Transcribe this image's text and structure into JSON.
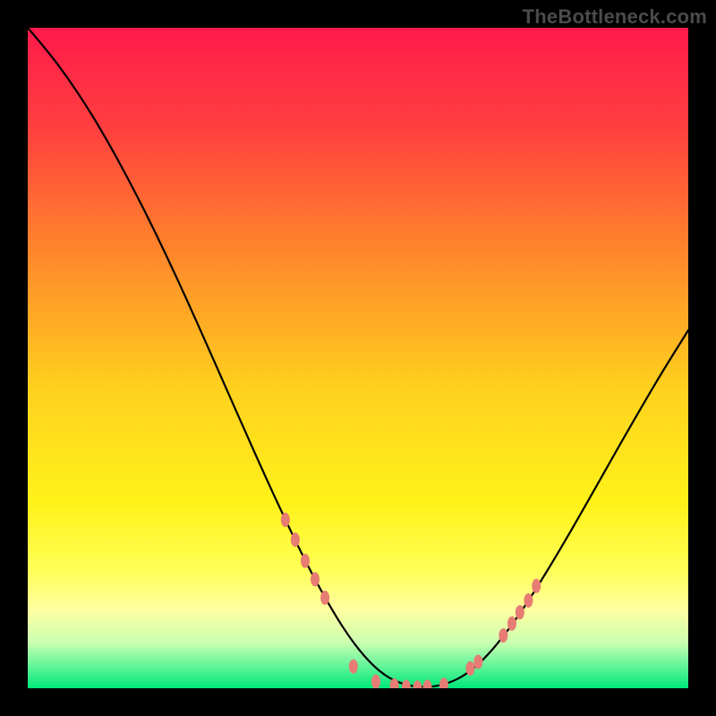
{
  "attribution": "TheBottleneck.com",
  "chart_data": {
    "type": "line",
    "title": "",
    "xlabel": "",
    "ylabel": "",
    "xlim": [
      0,
      100
    ],
    "ylim": [
      0,
      100
    ],
    "grid": false,
    "legend": false,
    "background_gradient": {
      "stops": [
        {
          "offset": 0.0,
          "color": "#ff1a4b"
        },
        {
          "offset": 0.15,
          "color": "#ff3f3f"
        },
        {
          "offset": 0.35,
          "color": "#ff8a2a"
        },
        {
          "offset": 0.55,
          "color": "#ffd21e"
        },
        {
          "offset": 0.72,
          "color": "#fff21a"
        },
        {
          "offset": 0.82,
          "color": "#ffff55"
        },
        {
          "offset": 0.88,
          "color": "#ffffa0"
        },
        {
          "offset": 0.93,
          "color": "#ccffb0"
        },
        {
          "offset": 0.965,
          "color": "#66f59a"
        },
        {
          "offset": 1.0,
          "color": "#00e879"
        }
      ]
    },
    "series": [
      {
        "name": "curve",
        "stroke": "#000000",
        "stroke_width": 2.2,
        "x": [
          0,
          3,
          6,
          9,
          12,
          15,
          18,
          21,
          24,
          27,
          30,
          33,
          36,
          39,
          42,
          45,
          48,
          51,
          54,
          57,
          60,
          63,
          66,
          69,
          72,
          75,
          78,
          81,
          84,
          87,
          90,
          93,
          96,
          100
        ],
        "y": [
          100,
          96.5,
          92.5,
          88,
          83,
          77.5,
          71.7,
          65.5,
          59,
          52.3,
          45.5,
          38.7,
          32,
          25.5,
          19.3,
          13.7,
          8.7,
          4.7,
          1.9,
          0.5,
          0.1,
          0.5,
          1.8,
          4.3,
          7.8,
          12,
          16.7,
          21.7,
          26.9,
          32.2,
          37.5,
          42.7,
          47.8,
          54.2
        ]
      }
    ],
    "markers": {
      "color": "#e77c74",
      "rx": 5,
      "ry": 8,
      "points": [
        {
          "x": 39.0,
          "y": 25.5
        },
        {
          "x": 40.5,
          "y": 22.5
        },
        {
          "x": 42.0,
          "y": 19.3
        },
        {
          "x": 43.5,
          "y": 16.5
        },
        {
          "x": 45.0,
          "y": 13.7
        },
        {
          "x": 49.3,
          "y": 3.3
        },
        {
          "x": 52.7,
          "y": 1.0
        },
        {
          "x": 55.5,
          "y": 0.4
        },
        {
          "x": 57.3,
          "y": 0.2
        },
        {
          "x": 59.0,
          "y": 0.1
        },
        {
          "x": 60.5,
          "y": 0.2
        },
        {
          "x": 63.0,
          "y": 0.5
        },
        {
          "x": 67.0,
          "y": 3.0
        },
        {
          "x": 68.2,
          "y": 4.0
        },
        {
          "x": 72.0,
          "y": 8.0
        },
        {
          "x": 73.3,
          "y": 9.8
        },
        {
          "x": 74.5,
          "y": 11.5
        },
        {
          "x": 75.8,
          "y": 13.3
        },
        {
          "x": 77.0,
          "y": 15.5
        }
      ]
    }
  }
}
